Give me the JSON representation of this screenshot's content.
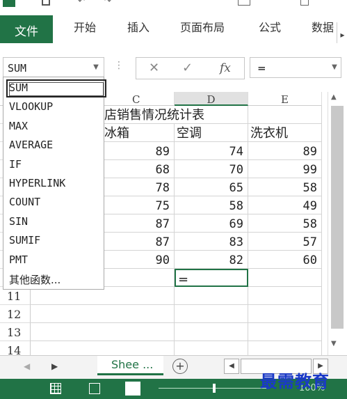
{
  "ribbon": {
    "file_tab": "文件",
    "tabs": [
      "开始",
      "插入",
      "页面布局",
      "公式",
      "数据"
    ],
    "scroll": "▸"
  },
  "formula_bar": {
    "namebox": "SUM",
    "cancel": "✕",
    "confirm": "✓",
    "fx": "fx",
    "formula": "="
  },
  "columns": [
    "C",
    "D",
    "E"
  ],
  "rows": [
    {
      "num": "",
      "cells": [
        "店销售情况统计表",
        "",
        ""
      ]
    },
    {
      "num": "",
      "cells": [
        "冰箱",
        "空调",
        "洗衣机"
      ]
    },
    {
      "num": "",
      "cells": [
        "89",
        "74",
        "89"
      ]
    },
    {
      "num": "",
      "cells": [
        "68",
        "70",
        "99"
      ]
    },
    {
      "num": "",
      "cells": [
        "78",
        "65",
        "58"
      ]
    },
    {
      "num": "",
      "cells": [
        "75",
        "58",
        "49"
      ]
    },
    {
      "num": "",
      "cells": [
        "87",
        "69",
        "58"
      ]
    },
    {
      "num": "",
      "cells": [
        "87",
        "83",
        "57"
      ]
    },
    {
      "num": "",
      "cells": [
        "90",
        "82",
        "60"
      ]
    },
    {
      "num": "",
      "cells": [
        "",
        "=",
        ""
      ]
    },
    {
      "num": "11",
      "cells": [
        "",
        "",
        ""
      ]
    },
    {
      "num": "12",
      "cells": [
        "",
        "",
        ""
      ]
    },
    {
      "num": "13",
      "cells": [
        "",
        "",
        ""
      ]
    },
    {
      "num": "14",
      "cells": [
        "",
        "",
        ""
      ]
    }
  ],
  "function_list": [
    "SUM",
    "VLOOKUP",
    "MAX",
    "AVERAGE",
    "IF",
    "HYPERLINK",
    "COUNT",
    "SIN",
    "SUMIF",
    "PMT",
    "其他函数..."
  ],
  "sheet_tab": "Shee ...",
  "status": {
    "zoom": "100%",
    "watermark": "最需教育"
  },
  "colors": {
    "excel_green": "#217346",
    "watermark_blue": "#1a39c8"
  }
}
